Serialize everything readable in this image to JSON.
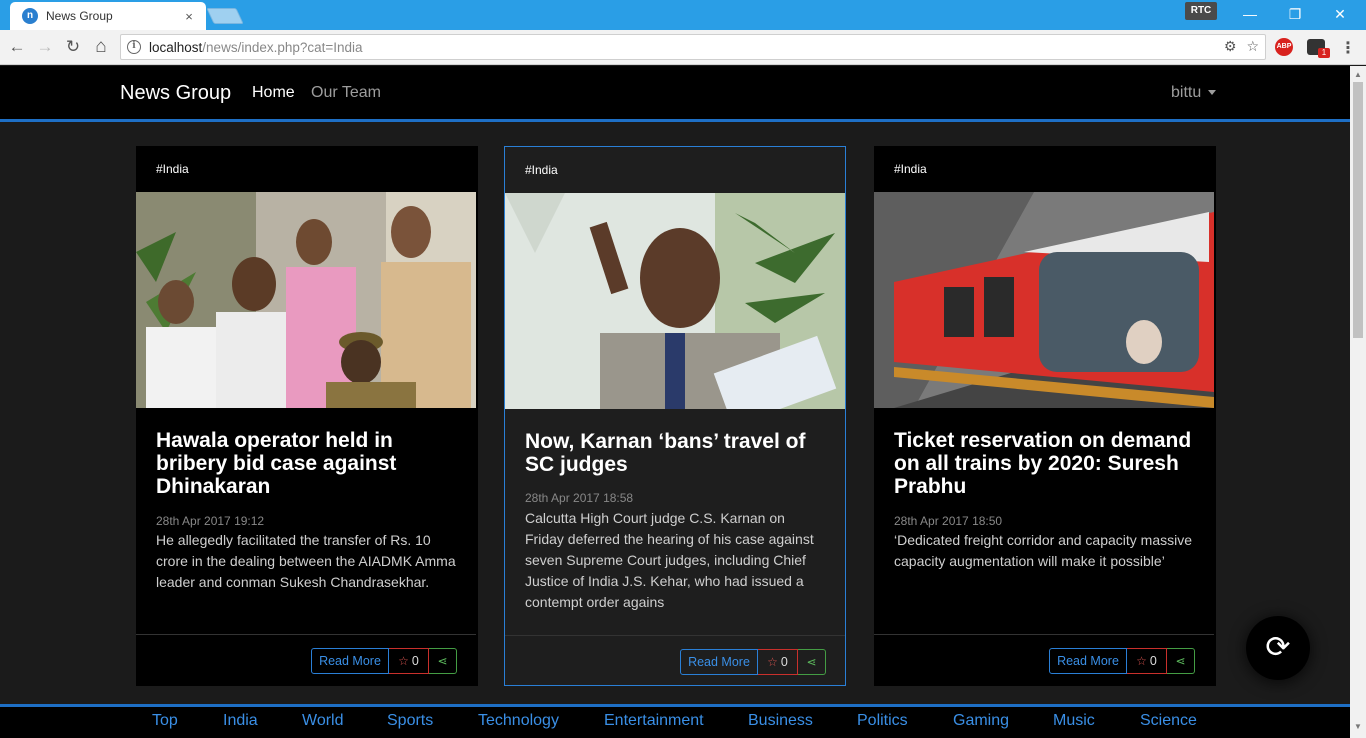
{
  "browser": {
    "tab_title": "News Group",
    "tab_close": "×",
    "favicon": "n",
    "rtc_badge": "RTC",
    "win_minimize": "—",
    "win_restore": "❐",
    "win_close": "✕",
    "url_host": "localhost",
    "url_path": "/news/index.php?cat=India",
    "info_icon": "i",
    "abp_label": "ABP",
    "ext_badge": "1",
    "menu_icon": "⋮",
    "back_icon": "←",
    "forward_icon": "→",
    "reload_icon": "↻",
    "home_icon": "⌂",
    "translate_icon": "⚙",
    "bookmark_icon": "☆"
  },
  "site_nav": {
    "brand": "News Group",
    "home": "Home",
    "our_team": "Our Team",
    "user": "bittu"
  },
  "cards": [
    {
      "tag": "#India",
      "title": "Hawala operator held in bribery bid case against Dhinakaran",
      "date": "28th Apr 2017 19:12",
      "description": "He allegedly facilitated the transfer of Rs. 10 crore in the dealing between the AIADMK Amma leader and conman Sukesh Chandrasekhar.",
      "read_more": "Read More",
      "stars": "0",
      "star_icon": "☆",
      "share_icon": "⋖"
    },
    {
      "tag": "#India",
      "title": "Now, Karnan ‘bans’ travel of SC judges",
      "date": "28th Apr 2017 18:58",
      "description": "Calcutta High Court judge C.S. Karnan on Friday deferred the hearing of his case against seven Supreme Court judges, including Chief Justice of India J.S. Kehar, who had issued a contempt order agains",
      "read_more": "Read More",
      "stars": "0",
      "star_icon": "☆",
      "share_icon": "⋖"
    },
    {
      "tag": "#India",
      "title": "Ticket reservation on demand on all trains by 2020: Suresh Prabhu",
      "date": "28th Apr 2017 18:50",
      "description": "‘Dedicated freight corridor and capacity massive capacity augmentation will make it possible’",
      "read_more": "Read More",
      "stars": "0",
      "star_icon": "☆",
      "share_icon": "⋖"
    }
  ],
  "refresh_icon": "⟳",
  "categories": [
    "Top",
    "India",
    "World",
    "Sports",
    "Technology",
    "Entertainment",
    "Business",
    "Politics",
    "Gaming",
    "Music",
    "Science"
  ],
  "colors": {
    "tabstrip": "#2a9ee6",
    "accent": "#1e6fc5",
    "link": "#3a8fe6",
    "star": "#d9534f",
    "share": "#5cb85c"
  }
}
